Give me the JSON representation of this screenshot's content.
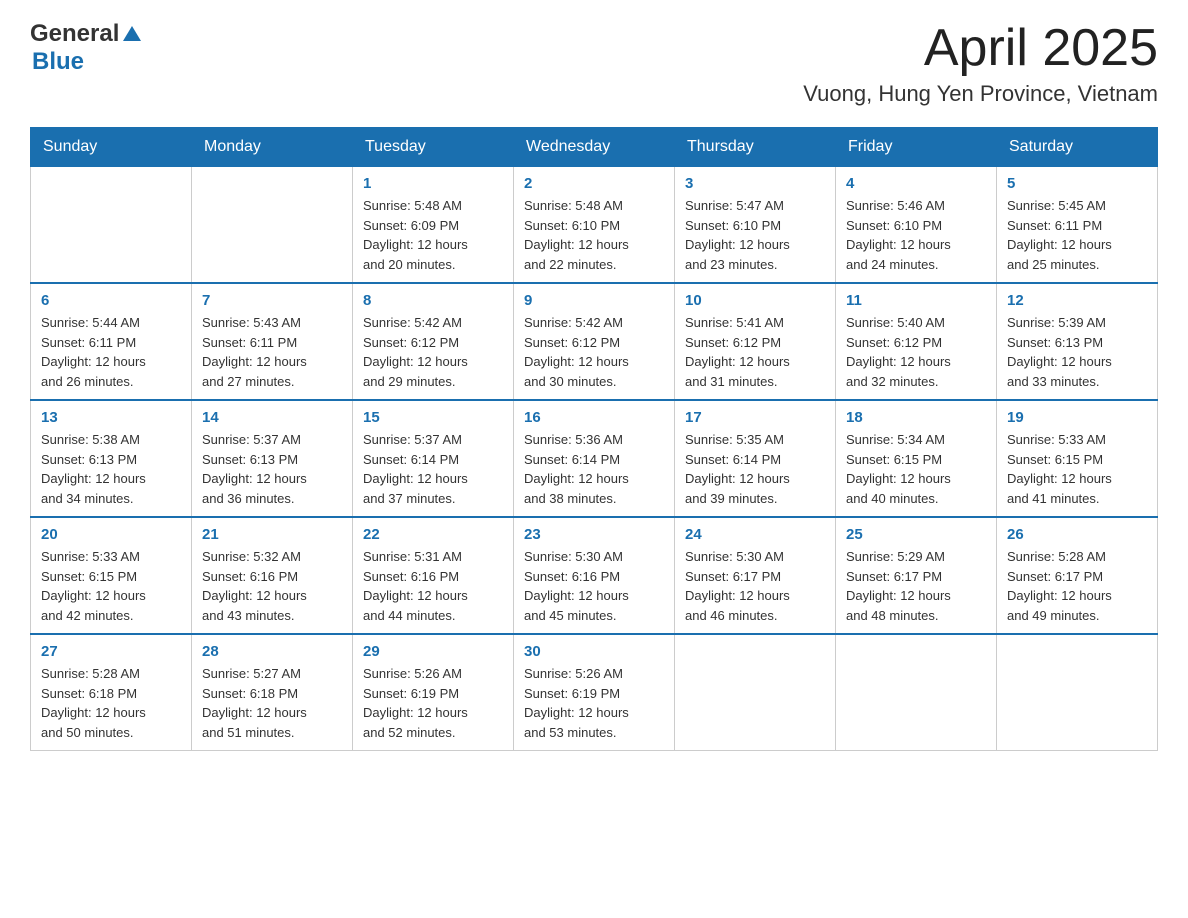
{
  "header": {
    "logo_general": "General",
    "logo_blue": "Blue",
    "title": "April 2025",
    "location": "Vuong, Hung Yen Province, Vietnam"
  },
  "calendar": {
    "days_of_week": [
      "Sunday",
      "Monday",
      "Tuesday",
      "Wednesday",
      "Thursday",
      "Friday",
      "Saturday"
    ],
    "weeks": [
      [
        {
          "day": "",
          "info": ""
        },
        {
          "day": "",
          "info": ""
        },
        {
          "day": "1",
          "info": "Sunrise: 5:48 AM\nSunset: 6:09 PM\nDaylight: 12 hours\nand 20 minutes."
        },
        {
          "day": "2",
          "info": "Sunrise: 5:48 AM\nSunset: 6:10 PM\nDaylight: 12 hours\nand 22 minutes."
        },
        {
          "day": "3",
          "info": "Sunrise: 5:47 AM\nSunset: 6:10 PM\nDaylight: 12 hours\nand 23 minutes."
        },
        {
          "day": "4",
          "info": "Sunrise: 5:46 AM\nSunset: 6:10 PM\nDaylight: 12 hours\nand 24 minutes."
        },
        {
          "day": "5",
          "info": "Sunrise: 5:45 AM\nSunset: 6:11 PM\nDaylight: 12 hours\nand 25 minutes."
        }
      ],
      [
        {
          "day": "6",
          "info": "Sunrise: 5:44 AM\nSunset: 6:11 PM\nDaylight: 12 hours\nand 26 minutes."
        },
        {
          "day": "7",
          "info": "Sunrise: 5:43 AM\nSunset: 6:11 PM\nDaylight: 12 hours\nand 27 minutes."
        },
        {
          "day": "8",
          "info": "Sunrise: 5:42 AM\nSunset: 6:12 PM\nDaylight: 12 hours\nand 29 minutes."
        },
        {
          "day": "9",
          "info": "Sunrise: 5:42 AM\nSunset: 6:12 PM\nDaylight: 12 hours\nand 30 minutes."
        },
        {
          "day": "10",
          "info": "Sunrise: 5:41 AM\nSunset: 6:12 PM\nDaylight: 12 hours\nand 31 minutes."
        },
        {
          "day": "11",
          "info": "Sunrise: 5:40 AM\nSunset: 6:12 PM\nDaylight: 12 hours\nand 32 minutes."
        },
        {
          "day": "12",
          "info": "Sunrise: 5:39 AM\nSunset: 6:13 PM\nDaylight: 12 hours\nand 33 minutes."
        }
      ],
      [
        {
          "day": "13",
          "info": "Sunrise: 5:38 AM\nSunset: 6:13 PM\nDaylight: 12 hours\nand 34 minutes."
        },
        {
          "day": "14",
          "info": "Sunrise: 5:37 AM\nSunset: 6:13 PM\nDaylight: 12 hours\nand 36 minutes."
        },
        {
          "day": "15",
          "info": "Sunrise: 5:37 AM\nSunset: 6:14 PM\nDaylight: 12 hours\nand 37 minutes."
        },
        {
          "day": "16",
          "info": "Sunrise: 5:36 AM\nSunset: 6:14 PM\nDaylight: 12 hours\nand 38 minutes."
        },
        {
          "day": "17",
          "info": "Sunrise: 5:35 AM\nSunset: 6:14 PM\nDaylight: 12 hours\nand 39 minutes."
        },
        {
          "day": "18",
          "info": "Sunrise: 5:34 AM\nSunset: 6:15 PM\nDaylight: 12 hours\nand 40 minutes."
        },
        {
          "day": "19",
          "info": "Sunrise: 5:33 AM\nSunset: 6:15 PM\nDaylight: 12 hours\nand 41 minutes."
        }
      ],
      [
        {
          "day": "20",
          "info": "Sunrise: 5:33 AM\nSunset: 6:15 PM\nDaylight: 12 hours\nand 42 minutes."
        },
        {
          "day": "21",
          "info": "Sunrise: 5:32 AM\nSunset: 6:16 PM\nDaylight: 12 hours\nand 43 minutes."
        },
        {
          "day": "22",
          "info": "Sunrise: 5:31 AM\nSunset: 6:16 PM\nDaylight: 12 hours\nand 44 minutes."
        },
        {
          "day": "23",
          "info": "Sunrise: 5:30 AM\nSunset: 6:16 PM\nDaylight: 12 hours\nand 45 minutes."
        },
        {
          "day": "24",
          "info": "Sunrise: 5:30 AM\nSunset: 6:17 PM\nDaylight: 12 hours\nand 46 minutes."
        },
        {
          "day": "25",
          "info": "Sunrise: 5:29 AM\nSunset: 6:17 PM\nDaylight: 12 hours\nand 48 minutes."
        },
        {
          "day": "26",
          "info": "Sunrise: 5:28 AM\nSunset: 6:17 PM\nDaylight: 12 hours\nand 49 minutes."
        }
      ],
      [
        {
          "day": "27",
          "info": "Sunrise: 5:28 AM\nSunset: 6:18 PM\nDaylight: 12 hours\nand 50 minutes."
        },
        {
          "day": "28",
          "info": "Sunrise: 5:27 AM\nSunset: 6:18 PM\nDaylight: 12 hours\nand 51 minutes."
        },
        {
          "day": "29",
          "info": "Sunrise: 5:26 AM\nSunset: 6:19 PM\nDaylight: 12 hours\nand 52 minutes."
        },
        {
          "day": "30",
          "info": "Sunrise: 5:26 AM\nSunset: 6:19 PM\nDaylight: 12 hours\nand 53 minutes."
        },
        {
          "day": "",
          "info": ""
        },
        {
          "day": "",
          "info": ""
        },
        {
          "day": "",
          "info": ""
        }
      ]
    ]
  }
}
